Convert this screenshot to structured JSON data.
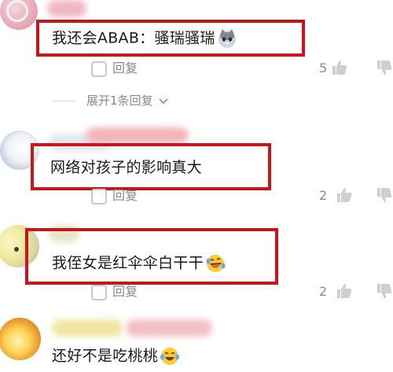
{
  "comments": [
    {
      "text": "我还会ABAB：骚瑞骚瑞",
      "emoji": "cat-face-icon",
      "reply_label": "回复",
      "likes": "5",
      "expand_label": "展开1条回复"
    },
    {
      "text": "网络对孩子的影响真大",
      "reply_label": "回复",
      "likes": "2"
    },
    {
      "text": "我侄女是红伞伞白干干",
      "emoji": "laughing-tears-icon",
      "reply_label": "回复",
      "likes": "2"
    },
    {
      "text": "还好不是吃桃桃",
      "emoji": "crying-laughing-icon"
    }
  ],
  "colors": {
    "highlight": "#c4161c",
    "meta_text": "#8a8a8a",
    "comment_text": "#1a1a1a"
  }
}
